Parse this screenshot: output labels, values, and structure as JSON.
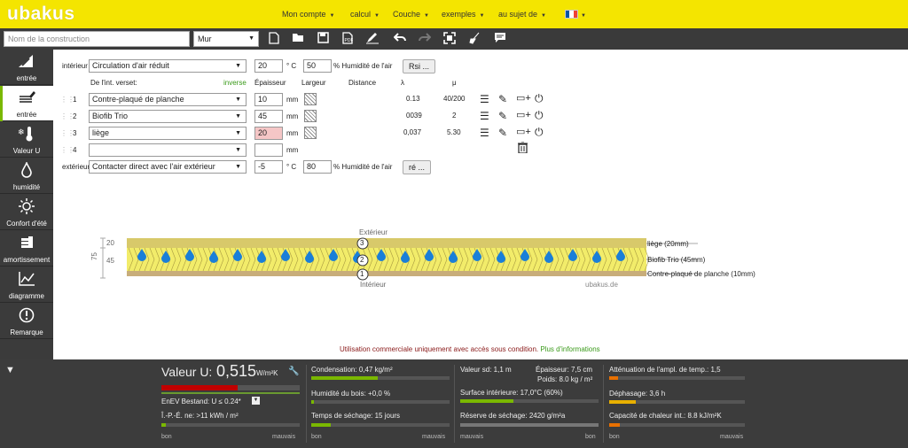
{
  "app": {
    "logo": "ubakus"
  },
  "top_menu": [
    {
      "label": "Mon compte"
    },
    {
      "label": "calcul"
    },
    {
      "label": "Couche"
    },
    {
      "label": "exemples"
    },
    {
      "label": "au sujet de"
    }
  ],
  "toolbar": {
    "construction_placeholder": "Nom de la construction",
    "construction_value": "",
    "type_select": "Mur",
    "icons": [
      "new-file-icon",
      "open-folder-icon",
      "save-icon",
      "pdf-icon",
      "edit-sign-icon",
      "undo-icon",
      "redo-icon",
      "fullscreen-icon",
      "clean-icon",
      "comment-icon"
    ]
  },
  "sidebar": {
    "items": [
      {
        "label": "entrée",
        "icon": "tools-icon",
        "active": false
      },
      {
        "label": "entrée",
        "icon": "layers-edit-icon",
        "active": true
      },
      {
        "label": "Valeur U",
        "icon": "thermometer-icon",
        "active": false
      },
      {
        "label": "humidité",
        "icon": "droplet-icon",
        "active": false
      },
      {
        "label": "Confort d'été",
        "icon": "sun-icon",
        "active": false
      },
      {
        "label": "amortissement",
        "icon": "coins-icon",
        "active": false
      },
      {
        "label": "diagramme",
        "icon": "chart-icon",
        "active": false
      },
      {
        "label": "Remarque",
        "icon": "exclamation-icon",
        "active": false
      }
    ]
  },
  "interior": {
    "label": "intérieur",
    "condition": "Circulation d'air réduit",
    "temp": "20",
    "temp_unit": "° C",
    "humidity": "50",
    "humidity_label": "% Humidité de l'air",
    "button": "Rsi ..."
  },
  "headers": {
    "from": "De l'int. verset:",
    "inverse": "inverse",
    "thickness": "Épaisseur",
    "width": "Largeur",
    "distance": "Distance",
    "lambda": "λ",
    "mu": "μ"
  },
  "layers": [
    {
      "num": "1",
      "material": "Contre-plaqué de planche",
      "thickness": "10",
      "unit": "mm",
      "lambda": "0.13",
      "mu": "40/200"
    },
    {
      "num": "2",
      "material": "Biofib Trio",
      "thickness": "45",
      "unit": "mm",
      "lambda": "0039",
      "mu": "2"
    },
    {
      "num": "3",
      "material": "liège",
      "thickness": "20",
      "unit": "mm",
      "lambda": "0,037",
      "mu": "5.30"
    },
    {
      "num": "4",
      "material": "",
      "thickness": "",
      "unit": "mm",
      "lambda": "",
      "mu": ""
    }
  ],
  "exterior": {
    "label": "extérieur",
    "condition": "Contacter direct avec l'air extérieur",
    "temp": "-5",
    "temp_unit": "° C",
    "humidity": "80",
    "humidity_label": "% Humidité de l'air",
    "button": "ré ..."
  },
  "drawing": {
    "top_label": "Extérieur",
    "bottom_label": "Intérieur",
    "watermark": "ubakus.de",
    "dims": {
      "a": "20",
      "b": "45",
      "total": "75"
    },
    "legend": [
      "liège (20mm)",
      "Biofib Trio (45mm)",
      "Contre-plaqué de planche (10mm)"
    ],
    "markers": [
      "3",
      "2",
      "1"
    ]
  },
  "footnote": {
    "text": "Utilisation commerciale uniquement avec accès sous condition.",
    "link": "Plus d'informations"
  },
  "bottom": {
    "collapse": "▼",
    "u_label": "Valeur U:",
    "u_value": "0,515",
    "u_unit": "W/m²K",
    "u_fill": 0.55,
    "enev": "EnEV Bestand: U ≤ 0.24*",
    "iepe": "Î.-P.-É. ne: >11 kWh / m²",
    "bon": "bon",
    "mauvais": "mauvais",
    "condensation": "Condensation: 0,47 kg/m²",
    "wood_humidity": "Humidité du bois: +0,0 %",
    "drying": "Temps de séchage: 15 jours",
    "sd": "Valeur sd: 1,1 m",
    "thickness": "Épaisseur: 7,5 cm",
    "weight": "Poids: 8.0 kg / m²",
    "surface": "Surface intérieure: 17,0°C (60%)",
    "reserve": "Réserve de séchage: 2420 g/m²a",
    "attenuation": "Atténuation de l'ampl. de temp.: 1,5",
    "phase": "Déphasage: 3,6 h",
    "capacity": "Capacité de chaleur int.: 8.8 kJ/m²K"
  },
  "colors": {
    "accent": "#f4e500",
    "dark": "#3a3a3a",
    "green": "#7ab800",
    "red": "#c00000"
  }
}
